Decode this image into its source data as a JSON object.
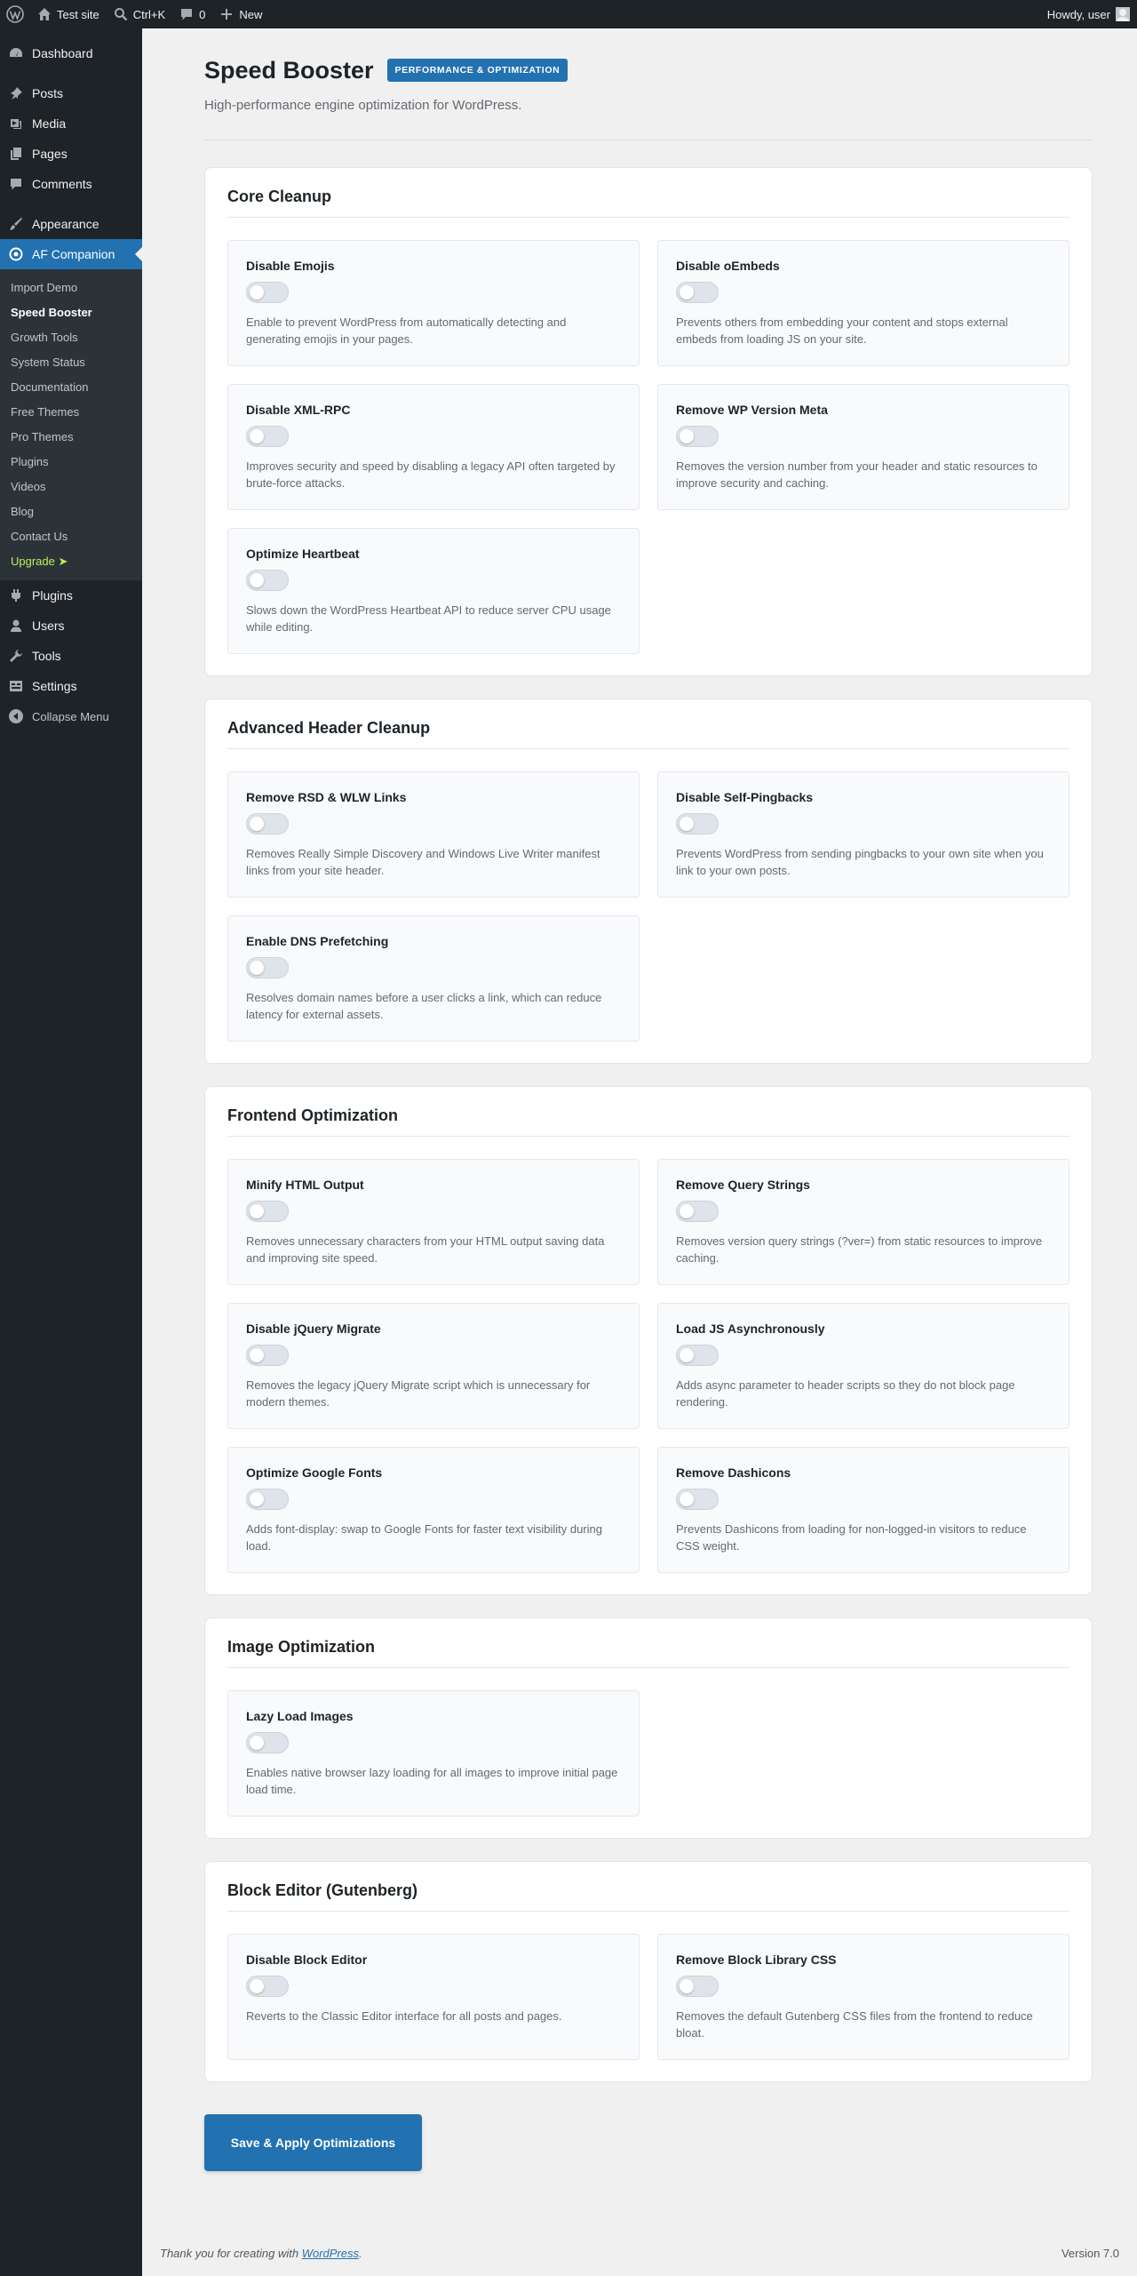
{
  "admin_bar": {
    "site_name": "Test site",
    "search_shortcut": "Ctrl+K",
    "comments_count": "0",
    "new_label": "New",
    "greeting": "Howdy, user"
  },
  "sidebar": {
    "items_top": [
      {
        "label": "Dashboard",
        "icon": "dashboard-icon"
      },
      {
        "label": "Posts",
        "icon": "pin-icon"
      },
      {
        "label": "Media",
        "icon": "media-icon"
      },
      {
        "label": "Pages",
        "icon": "pages-icon"
      },
      {
        "label": "Comments",
        "icon": "comments-icon"
      },
      {
        "label": "Appearance",
        "icon": "brush-icon"
      },
      {
        "label": "AF Companion",
        "icon": "companion-icon"
      }
    ],
    "submenu": [
      "Import Demo",
      "Speed Booster",
      "Growth Tools",
      "System Status",
      "Documentation",
      "Free Themes",
      "Pro Themes",
      "Plugins",
      "Videos",
      "Blog",
      "Contact Us",
      "Upgrade ➤"
    ],
    "items_bottom": [
      {
        "label": "Plugins",
        "icon": "plugin-icon"
      },
      {
        "label": "Users",
        "icon": "users-icon"
      },
      {
        "label": "Tools",
        "icon": "tools-icon"
      },
      {
        "label": "Settings",
        "icon": "settings-icon"
      }
    ],
    "collapse_label": "Collapse Menu"
  },
  "page": {
    "title": "Speed Booster",
    "badge": "PERFORMANCE & OPTIMIZATION",
    "subtitle": "High-performance engine optimization for WordPress."
  },
  "sections": [
    {
      "title": "Core Cleanup",
      "cards": [
        {
          "title": "Disable Emojis",
          "desc": "Enable to prevent WordPress from automatically detecting and generating emojis in your pages."
        },
        {
          "title": "Disable oEmbeds",
          "desc": "Prevents others from embedding your content and stops external embeds from loading JS on your site."
        },
        {
          "title": "Disable XML-RPC",
          "desc": "Improves security and speed by disabling a legacy API often targeted by brute-force attacks."
        },
        {
          "title": "Remove WP Version Meta",
          "desc": "Removes the version number from your header and static resources to improve security and caching."
        },
        {
          "title": "Optimize Heartbeat",
          "desc": "Slows down the WordPress Heartbeat API to reduce server CPU usage while editing."
        }
      ]
    },
    {
      "title": "Advanced Header Cleanup",
      "cards": [
        {
          "title": "Remove RSD & WLW Links",
          "desc": "Removes Really Simple Discovery and Windows Live Writer manifest links from your site header."
        },
        {
          "title": "Disable Self-Pingbacks",
          "desc": "Prevents WordPress from sending pingbacks to your own site when you link to your own posts."
        },
        {
          "title": "Enable DNS Prefetching",
          "desc": "Resolves domain names before a user clicks a link, which can reduce latency for external assets."
        }
      ]
    },
    {
      "title": "Frontend Optimization",
      "cards": [
        {
          "title": "Minify HTML Output",
          "desc": "Removes unnecessary characters from your HTML output saving data and improving site speed."
        },
        {
          "title": "Remove Query Strings",
          "desc": "Removes version query strings (?ver=) from static resources to improve caching."
        },
        {
          "title": "Disable jQuery Migrate",
          "desc": "Removes the legacy jQuery Migrate script which is unnecessary for modern themes."
        },
        {
          "title": "Load JS Asynchronously",
          "desc": "Adds async parameter to header scripts so they do not block page rendering."
        },
        {
          "title": "Optimize Google Fonts",
          "desc": "Adds font-display: swap to Google Fonts for faster text visibility during load."
        },
        {
          "title": "Remove Dashicons",
          "desc": "Prevents Dashicons from loading for non-logged-in visitors to reduce CSS weight."
        }
      ]
    },
    {
      "title": "Image Optimization",
      "cards": [
        {
          "title": "Lazy Load Images",
          "desc": "Enables native browser lazy loading for all images to improve initial page load time."
        }
      ]
    },
    {
      "title": "Block Editor (Gutenberg)",
      "cards": [
        {
          "title": "Disable Block Editor",
          "desc": "Reverts to the Classic Editor interface for all posts and pages."
        },
        {
          "title": "Remove Block Library CSS",
          "desc": "Removes the default Gutenberg CSS files from the frontend to reduce bloat."
        }
      ]
    }
  ],
  "save_button": "Save & Apply Optimizations",
  "footer": {
    "thanks_prefix": "Thank you for creating with ",
    "link": "WordPress",
    "thanks_suffix": ".",
    "version": "Version 7.0"
  },
  "colors": {
    "admin_bg": "#1d2327",
    "accent": "#2271b1",
    "upgrade": "#b5f15b",
    "page_bg": "#f0f0f1"
  }
}
